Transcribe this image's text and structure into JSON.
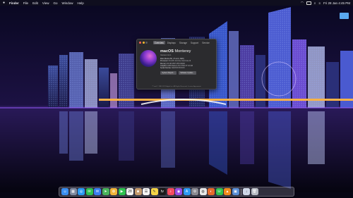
{
  "menubar": {
    "items": [
      "Finder",
      "File",
      "Edit",
      "View",
      "Go",
      "Window",
      "Help"
    ],
    "clock": "Fri 28 Jan 4:45 PM"
  },
  "about_window": {
    "tabs": [
      "Overview",
      "Displays",
      "Storage",
      "Support",
      "Service"
    ],
    "os_name_bold": "macOS",
    "os_name": "Monterey",
    "version": "Version 12.1",
    "specs": [
      {
        "k": "iMac (Retina 5K, 27-inch, 2020)",
        "v": ""
      },
      {
        "k": "Processor",
        "v": "3.6 GHz 10-Core Intel Core i9"
      },
      {
        "k": "Memory",
        "v": "64 GB 2667 MHz DDR4"
      },
      {
        "k": "Graphics",
        "v": "AMD Radeon Pro 5700 XT 16 GB"
      },
      {
        "k": "Serial Number",
        "v": "C02XXXXXXXXX"
      }
    ],
    "buttons": [
      "System Report...",
      "Software Update..."
    ],
    "footer": "™ and © 1983-2021 Apple Inc. All Rights Reserved. License Agreement"
  },
  "dock": {
    "apps": [
      {
        "name": "finder-icon",
        "color": "#3a8ef0",
        "glyph": "☺"
      },
      {
        "name": "launchpad-icon",
        "color": "#7f8aa0",
        "glyph": "▦"
      },
      {
        "name": "safari-icon",
        "color": "#2b9af3",
        "glyph": "◎"
      },
      {
        "name": "messages-icon",
        "color": "#2fc14f",
        "glyph": "✉"
      },
      {
        "name": "mail-icon",
        "color": "#3a7ff0",
        "glyph": "✉"
      },
      {
        "name": "maps-icon",
        "color": "#49b35b",
        "glyph": "➤"
      },
      {
        "name": "photos-icon",
        "color": "#f0b43a",
        "glyph": "✿"
      },
      {
        "name": "facetime-icon",
        "color": "#2fc14f",
        "glyph": "▶"
      },
      {
        "name": "calendar-icon",
        "color": "#f4f4f4",
        "glyph": "28"
      },
      {
        "name": "contacts-icon",
        "color": "#c49a6c",
        "glyph": "☻"
      },
      {
        "name": "reminders-icon",
        "color": "#f4f4f4",
        "glyph": "☰"
      },
      {
        "name": "notes-icon",
        "color": "#f5d547",
        "glyph": "✎"
      },
      {
        "name": "tv-icon",
        "color": "#1b1b1b",
        "glyph": "tv"
      },
      {
        "name": "music-icon",
        "color": "#f54b5e",
        "glyph": "♪"
      },
      {
        "name": "podcasts-icon",
        "color": "#9a4de6",
        "glyph": "◉"
      },
      {
        "name": "app-store-icon",
        "color": "#2b9af3",
        "glyph": "A"
      },
      {
        "name": "system-preferences-icon",
        "color": "#8b8b92",
        "glyph": "⚙"
      },
      {
        "name": "chrome-icon",
        "color": "#e8e8e8",
        "glyph": "◍"
      },
      {
        "name": "firefox-icon",
        "color": "#e66a2c",
        "glyph": "◐"
      },
      {
        "name": "whatsapp-icon",
        "color": "#2fc14f",
        "glyph": "☏"
      },
      {
        "name": "vlc-icon",
        "color": "#f28b1c",
        "glyph": "▲"
      },
      {
        "name": "preview-icon",
        "color": "#5a8fd6",
        "glyph": "▣"
      }
    ],
    "trailing": [
      {
        "name": "downloads-folder-icon",
        "color": "#cfd8e8",
        "glyph": "↓"
      },
      {
        "name": "trash-icon",
        "color": "#b8bcc4",
        "glyph": "🗑"
      }
    ]
  },
  "desktop": {
    "folder_label": ""
  }
}
